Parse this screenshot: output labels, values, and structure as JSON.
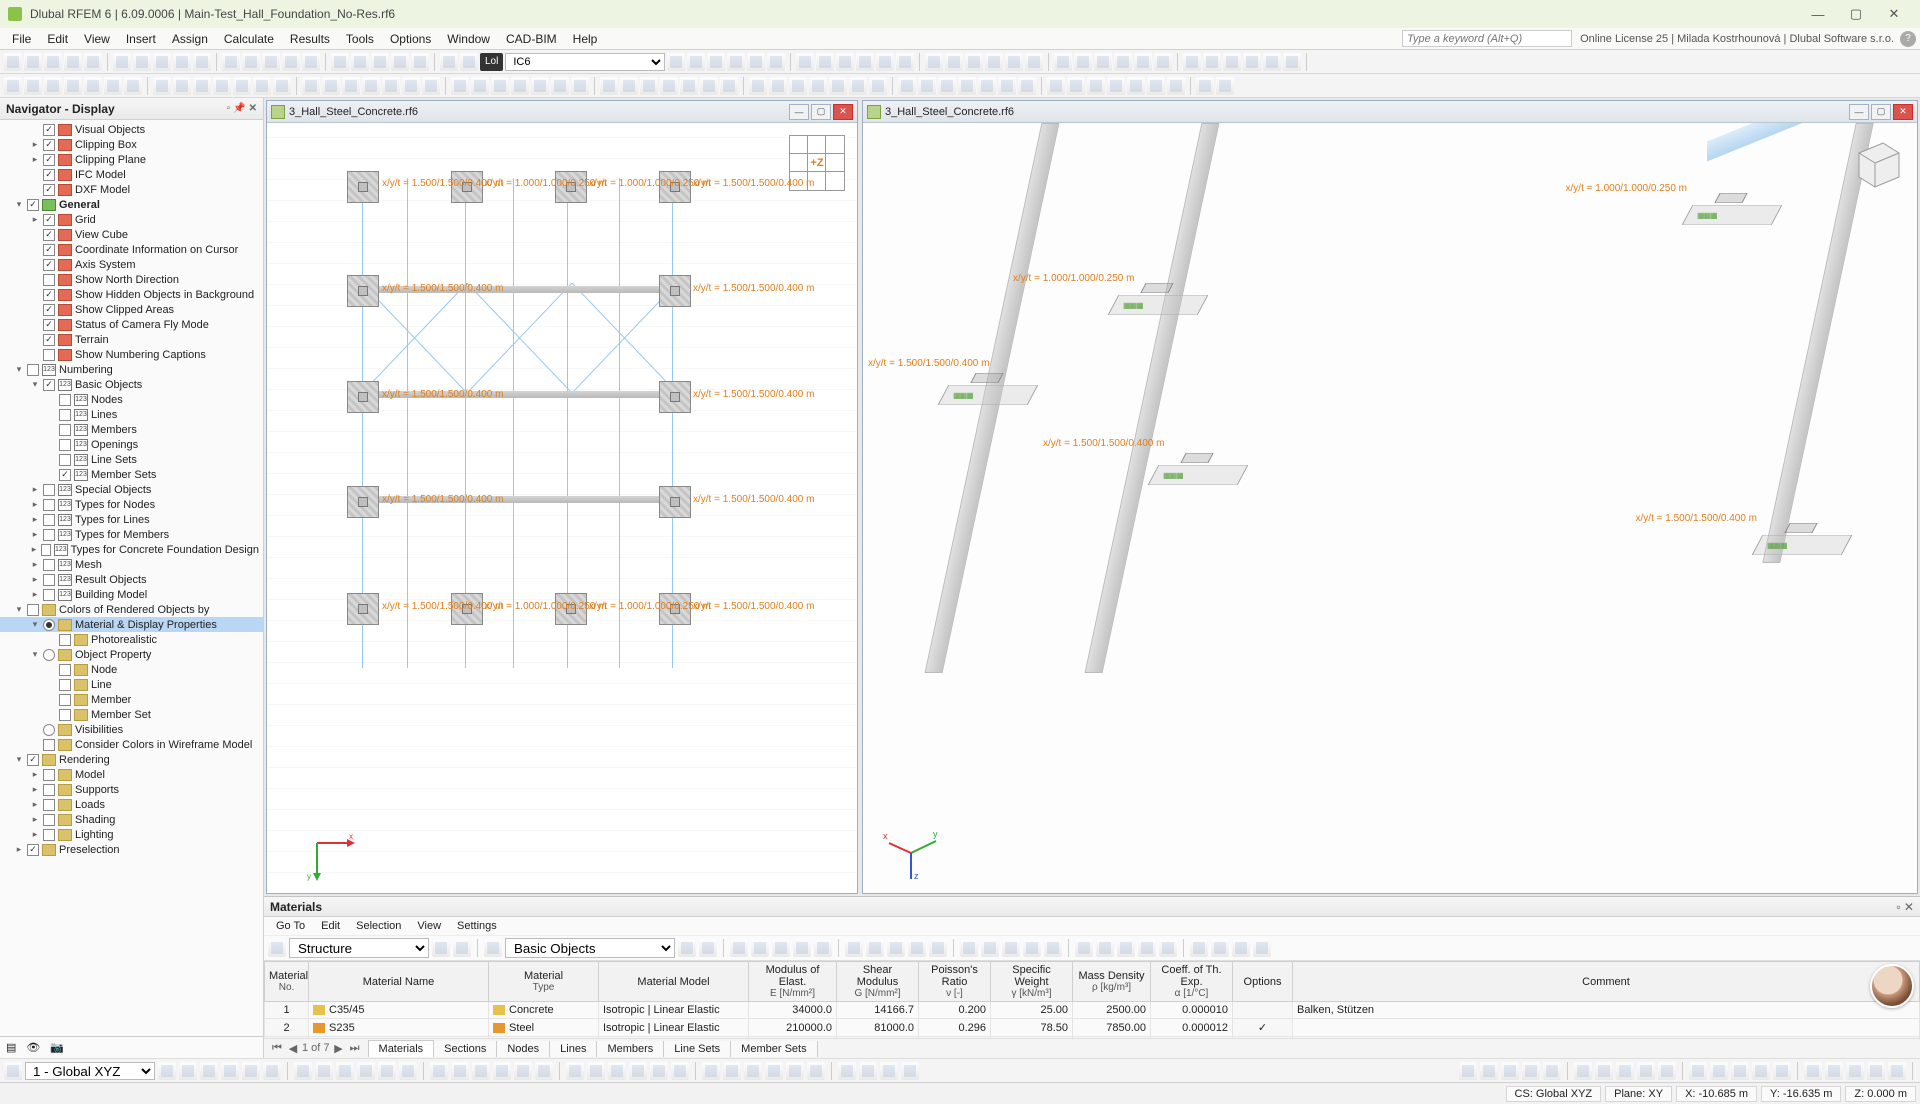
{
  "window": {
    "title": "Dlubal RFEM 6 | 6.09.0006 | Main-Test_Hall_Foundation_No-Res.rf6",
    "license": "Online License 25 | Milada Kostrhounová | Dlubal Software s.r.o.",
    "search_placeholder": "Type a keyword (Alt+Q)"
  },
  "menus": [
    "File",
    "Edit",
    "View",
    "Insert",
    "Assign",
    "Calculate",
    "Results",
    "Tools",
    "Options",
    "Window",
    "CAD-BIM",
    "Help"
  ],
  "combo1": "IC6",
  "tbox": "Lol",
  "navigator": {
    "title": "Navigator - Display",
    "items": [
      {
        "d": 0,
        "exp": "",
        "cb": true,
        "ico": "red",
        "label": "Visual Objects"
      },
      {
        "d": 0,
        "exp": "▸",
        "cb": true,
        "ico": "red",
        "label": "Clipping Box"
      },
      {
        "d": 0,
        "exp": "▸",
        "cb": true,
        "ico": "red",
        "label": "Clipping Plane"
      },
      {
        "d": 0,
        "exp": "",
        "cb": true,
        "ico": "red",
        "label": "IFC Model"
      },
      {
        "d": 0,
        "exp": "",
        "cb": true,
        "ico": "red",
        "label": "DXF Model"
      },
      {
        "d": -1,
        "exp": "▾",
        "cb": true,
        "ico": "grn",
        "label": "General",
        "bold": true
      },
      {
        "d": 0,
        "exp": "▸",
        "cb": true,
        "ico": "red",
        "label": "Grid"
      },
      {
        "d": 0,
        "exp": "",
        "cb": true,
        "ico": "red",
        "label": "View Cube"
      },
      {
        "d": 0,
        "exp": "",
        "cb": true,
        "ico": "red",
        "label": "Coordinate Information on Cursor"
      },
      {
        "d": 0,
        "exp": "",
        "cb": true,
        "ico": "red",
        "label": "Axis System"
      },
      {
        "d": 0,
        "exp": "",
        "cb": false,
        "ico": "red",
        "label": "Show North Direction"
      },
      {
        "d": 0,
        "exp": "",
        "cb": true,
        "ico": "red",
        "label": "Show Hidden Objects in Background"
      },
      {
        "d": 0,
        "exp": "",
        "cb": true,
        "ico": "red",
        "label": "Show Clipped Areas"
      },
      {
        "d": 0,
        "exp": "",
        "cb": true,
        "ico": "red",
        "label": "Status of Camera Fly Mode"
      },
      {
        "d": 0,
        "exp": "",
        "cb": true,
        "ico": "red",
        "label": "Terrain"
      },
      {
        "d": 0,
        "exp": "",
        "cb": false,
        "ico": "red",
        "label": "Show Numbering Captions"
      },
      {
        "d": -1,
        "exp": "▾",
        "cb": false,
        "ico": "num",
        "label": "Numbering"
      },
      {
        "d": 0,
        "exp": "▾",
        "cb": true,
        "ico": "num",
        "label": "Basic Objects"
      },
      {
        "d": 1,
        "exp": "",
        "cb": false,
        "ico": "num",
        "label": "Nodes"
      },
      {
        "d": 1,
        "exp": "",
        "cb": false,
        "ico": "num",
        "label": "Lines"
      },
      {
        "d": 1,
        "exp": "",
        "cb": false,
        "ico": "num",
        "label": "Members"
      },
      {
        "d": 1,
        "exp": "",
        "cb": false,
        "ico": "num",
        "label": "Openings"
      },
      {
        "d": 1,
        "exp": "",
        "cb": false,
        "ico": "num",
        "label": "Line Sets"
      },
      {
        "d": 1,
        "exp": "",
        "cb": true,
        "ico": "num",
        "label": "Member Sets"
      },
      {
        "d": 0,
        "exp": "▸",
        "cb": false,
        "ico": "num",
        "label": "Special Objects"
      },
      {
        "d": 0,
        "exp": "▸",
        "cb": false,
        "ico": "num",
        "label": "Types for Nodes"
      },
      {
        "d": 0,
        "exp": "▸",
        "cb": false,
        "ico": "num",
        "label": "Types for Lines"
      },
      {
        "d": 0,
        "exp": "▸",
        "cb": false,
        "ico": "num",
        "label": "Types for Members"
      },
      {
        "d": 0,
        "exp": "▸",
        "cb": false,
        "ico": "num",
        "label": "Types for Concrete Foundation Design"
      },
      {
        "d": 0,
        "exp": "▸",
        "cb": false,
        "ico": "num",
        "label": "Mesh"
      },
      {
        "d": 0,
        "exp": "▸",
        "cb": false,
        "ico": "num",
        "label": "Result Objects"
      },
      {
        "d": 0,
        "exp": "▸",
        "cb": false,
        "ico": "num",
        "label": "Building Model"
      },
      {
        "d": -1,
        "exp": "▾",
        "cb": false,
        "ico": "",
        "radio": false,
        "label": "Colors of Rendered Objects by"
      },
      {
        "d": 0,
        "exp": "▾",
        "cb": null,
        "radio": true,
        "ico": "",
        "label": "Material & Display Properties",
        "sel": true
      },
      {
        "d": 1,
        "exp": "",
        "cb": false,
        "ico": "",
        "label": "Photorealistic"
      },
      {
        "d": 0,
        "exp": "▾",
        "cb": null,
        "radio": false,
        "ico": "",
        "label": "Object Property"
      },
      {
        "d": 1,
        "exp": "",
        "cb": false,
        "ico": "",
        "label": "Node"
      },
      {
        "d": 1,
        "exp": "",
        "cb": false,
        "ico": "",
        "label": "Line"
      },
      {
        "d": 1,
        "exp": "",
        "cb": false,
        "ico": "",
        "label": "Member"
      },
      {
        "d": 1,
        "exp": "",
        "cb": false,
        "ico": "",
        "label": "Member Set"
      },
      {
        "d": 0,
        "exp": "",
        "cb": null,
        "radio": false,
        "ico": "",
        "label": "Visibilities"
      },
      {
        "d": 0,
        "exp": "",
        "cb": false,
        "ico": "",
        "label": "Consider Colors in Wireframe Model"
      },
      {
        "d": -1,
        "exp": "▾",
        "cb": true,
        "ico": "",
        "label": "Rendering"
      },
      {
        "d": 0,
        "exp": "▸",
        "cb": false,
        "ico": "",
        "label": "Model"
      },
      {
        "d": 0,
        "exp": "▸",
        "cb": false,
        "ico": "",
        "label": "Supports"
      },
      {
        "d": 0,
        "exp": "▸",
        "cb": false,
        "ico": "",
        "label": "Loads"
      },
      {
        "d": 0,
        "exp": "▸",
        "cb": false,
        "ico": "",
        "label": "Shading"
      },
      {
        "d": 0,
        "exp": "▸",
        "cb": false,
        "ico": "",
        "label": "Lighting"
      },
      {
        "d": -1,
        "exp": "▸",
        "cb": true,
        "ico": "",
        "label": "Preselection"
      }
    ]
  },
  "views": {
    "doc_title": "3_Hall_Steel_Concrete.rf6",
    "navcube": "+Z",
    "dim_small": "x/y/t = 1.000/1.000/0.250 m",
    "dim_big": "x/y/t = 1.500/1.500/0.400 m"
  },
  "materials": {
    "title": "Materials",
    "menu": [
      "Go To",
      "Edit",
      "Selection",
      "View",
      "Settings"
    ],
    "type_sel": "Structure",
    "obj_sel": "Basic Objects",
    "page": "1 of 7",
    "headers": [
      {
        "t": "Material",
        "s": "No."
      },
      {
        "t": "Material Name",
        "s": ""
      },
      {
        "t": "Material",
        "s": "Type"
      },
      {
        "t": "Material Model",
        "s": ""
      },
      {
        "t": "Modulus of Elast.",
        "s": "E [N/mm²]"
      },
      {
        "t": "Shear Modulus",
        "s": "G [N/mm²]"
      },
      {
        "t": "Poisson's Ratio",
        "s": "ν [-]"
      },
      {
        "t": "Specific Weight",
        "s": "γ [kN/m³]"
      },
      {
        "t": "Mass Density",
        "s": "ρ [kg/m³]"
      },
      {
        "t": "Coeff. of Th. Exp.",
        "s": "α [1/°C]"
      },
      {
        "t": "Options",
        "s": ""
      },
      {
        "t": "Comment",
        "s": ""
      }
    ],
    "rows": [
      {
        "no": "1",
        "name": "C35/45",
        "color": "#e6c24d",
        "type": "Concrete",
        "model": "Isotropic | Linear Elastic",
        "E": "34000.0",
        "G": "14166.7",
        "nu": "0.200",
        "gamma": "25.00",
        "rho": "2500.00",
        "alpha": "0.000010",
        "opt": "",
        "cmt": "Balken, Stützen"
      },
      {
        "no": "2",
        "name": "S235",
        "color": "#e8962e",
        "type": "Steel",
        "model": "Isotropic | Linear Elastic",
        "E": "210000.0",
        "G": "81000.0",
        "nu": "0.296",
        "gamma": "78.50",
        "rho": "7850.00",
        "alpha": "0.000012",
        "opt": "✓",
        "cmt": ""
      }
    ],
    "tabs": [
      "Materials",
      "Sections",
      "Nodes",
      "Lines",
      "Members",
      "Line Sets",
      "Member Sets"
    ]
  },
  "status": {
    "cs": "1 - Global XYZ",
    "plane": "Plane: XY",
    "x": "X: -10.685 m",
    "y": "Y: -16.635 m",
    "z": "Z: 0.000 m",
    "csr": "CS: Global XYZ"
  }
}
